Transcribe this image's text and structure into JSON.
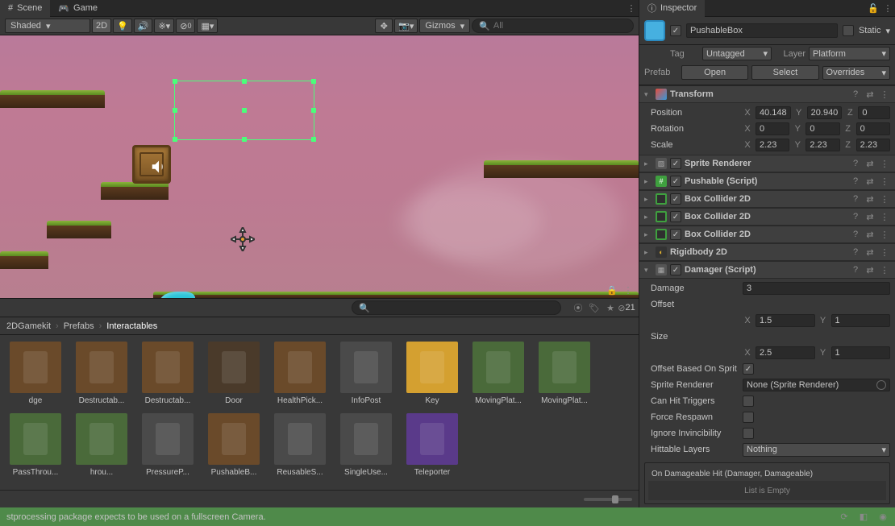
{
  "tabs": {
    "scene": "Scene",
    "game": "Game",
    "inspector": "Inspector"
  },
  "toolbar": {
    "shading": "Shaded",
    "mode2d": "2D",
    "gizmos": "Gizmos",
    "search_placeholder": "All"
  },
  "project": {
    "hidden_count": "21",
    "crumbs": [
      "2DGamekit",
      "Prefabs",
      "Interactables"
    ],
    "assets": [
      "dge",
      "Destructab...",
      "Destructab...",
      "Door",
      "HealthPick...",
      "InfoPost",
      "Key",
      "MovingPlat...",
      "MovingPlat...",
      "PassThrou...",
      "hrou...",
      "PressureP...",
      "PushableB...",
      "ReusableS...",
      "SingleUse...",
      "Teleporter"
    ]
  },
  "inspector": {
    "name": "PushableBox",
    "static": "Static",
    "tag_label": "Tag",
    "tag": "Untagged",
    "layer_label": "Layer",
    "layer": "Platform",
    "prefab_label": "Prefab",
    "open": "Open",
    "select": "Select",
    "overrides": "Overrides",
    "transform": {
      "title": "Transform",
      "position": "Position",
      "px": "40.148",
      "py": "20.940",
      "pz": "0",
      "rotation": "Rotation",
      "rx": "0",
      "ry": "0",
      "rz": "0",
      "scale": "Scale",
      "sx": "2.23",
      "sy": "2.23",
      "sz": "2.23"
    },
    "components": {
      "sprite_renderer": "Sprite Renderer",
      "pushable": "Pushable (Script)",
      "box_collider": "Box Collider 2D",
      "rigidbody": "Rigidbody 2D",
      "damager": "Damager (Script)"
    },
    "damager": {
      "damage_label": "Damage",
      "damage": "3",
      "offset": "Offset",
      "ox": "1.5",
      "oy": "1",
      "size": "Size",
      "sx": "2.5",
      "sy": "1",
      "offset_sprite": "Offset Based On Sprit",
      "sprite_renderer_label": "Sprite Renderer",
      "sprite_renderer_value": "None (Sprite Renderer)",
      "can_hit_triggers": "Can Hit Triggers",
      "force_respawn": "Force Respawn",
      "ignore_invincibility": "Ignore Invincibility",
      "hittable_layers": "Hittable Layers",
      "hittable_value": "Nothing",
      "event_title": "On Damageable Hit (Damager, Damageable)",
      "event_empty": "List is Empty"
    }
  },
  "status": "stprocessing package expects to be used on a fullscreen Camera."
}
